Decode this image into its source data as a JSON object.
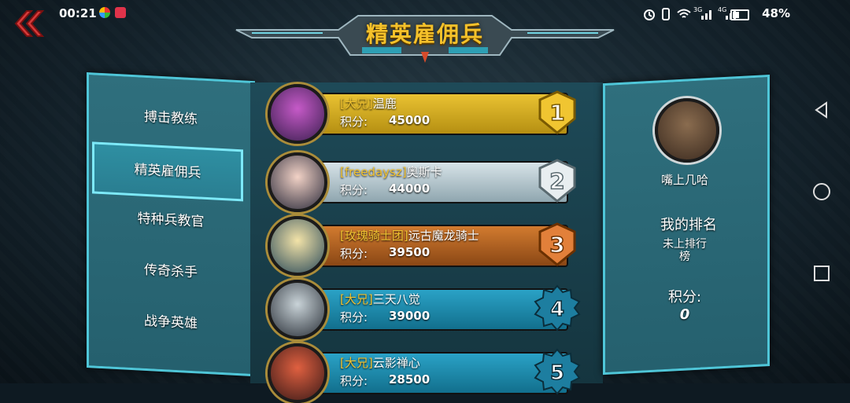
{
  "status_bar": {
    "time": "00:21",
    "battery": "48%",
    "net_3g": "3G",
    "net_4g": "4G"
  },
  "title": "精英雇佣兵",
  "menu": {
    "items": [
      {
        "label": "搏击教练",
        "active": false
      },
      {
        "label": "精英雇佣兵",
        "active": true
      },
      {
        "label": "特种兵教官",
        "active": false
      },
      {
        "label": "传奇杀手",
        "active": false
      },
      {
        "label": "战争英雄",
        "active": false
      }
    ]
  },
  "leaderboard": {
    "points_label": "积分:",
    "rows": [
      {
        "rank": "1",
        "guild": "[大兄]",
        "name": "温鹿",
        "points": "45000",
        "style": "gold"
      },
      {
        "rank": "2",
        "guild": "[freedaysz]",
        "name": "奥斯卡",
        "points": "44000",
        "style": "silver"
      },
      {
        "rank": "3",
        "guild": "[玫瑰骑士团]",
        "name": "远古魔龙骑士",
        "points": "39500",
        "style": "bronze"
      },
      {
        "rank": "4",
        "guild": "[大兄]",
        "name": "三天八觉",
        "points": "39000",
        "style": "blue"
      },
      {
        "rank": "5",
        "guild": "[大兄]",
        "name": "云影禅心",
        "points": "28500",
        "style": "blue"
      }
    ]
  },
  "my_rank": {
    "player_name": "嘴上几哈",
    "rank_title": "我的排名",
    "rank_line1": "未上排行",
    "rank_line2": "榜",
    "points_label": "积分:",
    "points": "0"
  },
  "colors": {
    "title": "#f5c12a",
    "panel": "#2f6f7d",
    "panel_border": "#4fc6d8",
    "guild": "#f2c331"
  }
}
